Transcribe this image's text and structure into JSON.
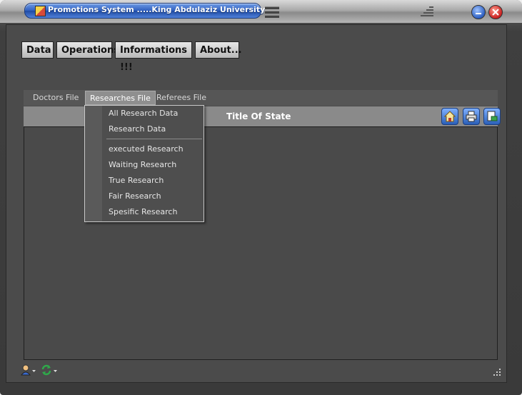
{
  "window": {
    "title": "Promotions System .....King Abdulaziz University"
  },
  "menubar": {
    "items": [
      {
        "label": "Data"
      },
      {
        "label": "Operations"
      },
      {
        "label": "Informations !!!"
      },
      {
        "label": "About..."
      }
    ]
  },
  "tabs": [
    {
      "label": "Doctors  File",
      "active": false
    },
    {
      "label": "Researches File",
      "active": true
    },
    {
      "label": "Referees File",
      "active": false
    }
  ],
  "header": {
    "title": "Title Of State",
    "toolbar_icons": [
      "home-icon",
      "print-icon",
      "export-icon"
    ]
  },
  "dropdown": {
    "items": [
      {
        "label": "All Research Data"
      },
      {
        "label": "Research Data"
      },
      {
        "label": "executed Research"
      },
      {
        "label": "Waiting Research"
      },
      {
        "label": "True Research"
      },
      {
        "label": "Fair Research"
      },
      {
        "label": "Spesific Research"
      }
    ]
  },
  "statusbar": {
    "icons": [
      "user-icon",
      "refresh-icon"
    ]
  },
  "colors": {
    "title_pill": "#2f5fbf",
    "client_bg": "#4b4b4b",
    "header_band": "#8a8a8a"
  }
}
